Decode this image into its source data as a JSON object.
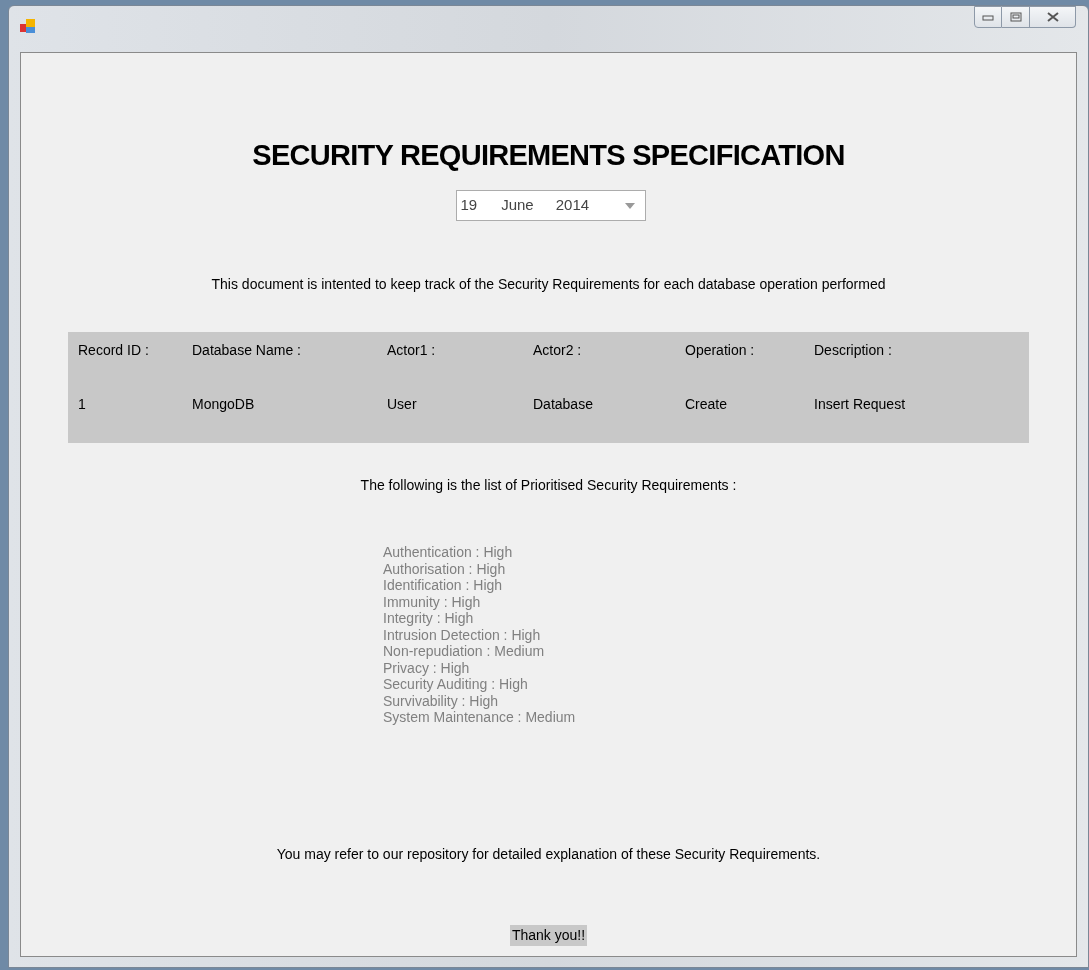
{
  "window": {
    "controls": [
      {
        "kind": "minimize"
      },
      {
        "kind": "maximize"
      },
      {
        "kind": "close"
      }
    ]
  },
  "title": "SECURITY REQUIREMENTS SPECIFICATION",
  "date_picker": {
    "day": "19",
    "month": "June",
    "year": "2014"
  },
  "intro": "This document is intented to keep track of the Security Requirements for each database operation performed",
  "record": {
    "columns": [
      "Record ID :",
      "Database Name :",
      "Actor1 :",
      "Actor2 :",
      "Operation :",
      "Description :"
    ],
    "values": [
      "1",
      "MongoDB",
      "User",
      "Database",
      "Create",
      "Insert Request"
    ]
  },
  "list_heading": "The following is the list of Prioritised Security Requirements :",
  "requirements": [
    "Authentication : High",
    "Authorisation : High",
    "Identification : High",
    "Immunity : High",
    "Integrity : High",
    "Intrusion Detection : High",
    "Non-repudiation : Medium",
    "Privacy : High",
    "Security Auditing : High",
    "Survivability : High",
    "System Maintenance : Medium"
  ],
  "footer": "You may refer to our repository for detailed explanation of these Security Requirements.",
  "thanks": "Thank you!!"
}
